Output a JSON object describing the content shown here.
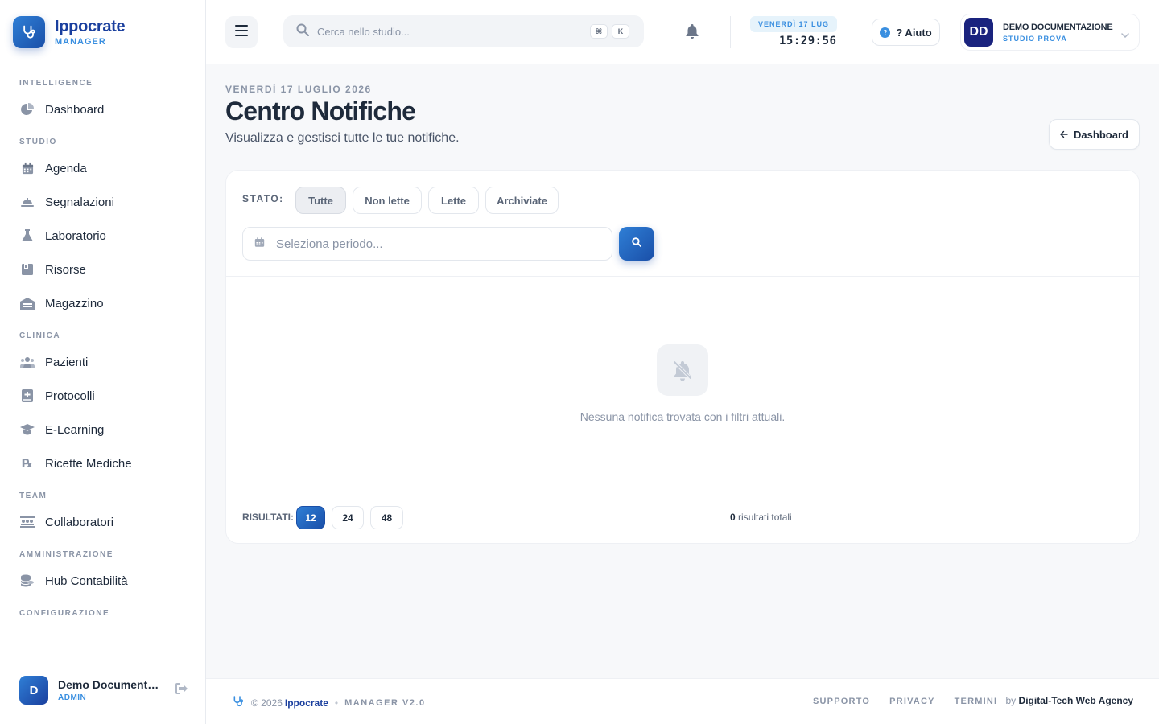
{
  "brand": {
    "name": "Ippocrate",
    "subtitle": "MANAGER"
  },
  "sidebar": {
    "sections": [
      {
        "title": "INTELLIGENCE",
        "items": [
          {
            "label": "Dashboard",
            "icon": "pie-chart-icon"
          }
        ]
      },
      {
        "title": "STUDIO",
        "items": [
          {
            "label": "Agenda",
            "icon": "calendar-icon"
          },
          {
            "label": "Segnalazioni",
            "icon": "bell-service-icon"
          },
          {
            "label": "Laboratorio",
            "icon": "flask-icon"
          },
          {
            "label": "Risorse",
            "icon": "box-icon"
          },
          {
            "label": "Magazzino",
            "icon": "warehouse-icon"
          }
        ]
      },
      {
        "title": "CLINICA",
        "items": [
          {
            "label": "Pazienti",
            "icon": "users-icon"
          },
          {
            "label": "Protocolli",
            "icon": "medical-book-icon"
          },
          {
            "label": "E-Learning",
            "icon": "graduation-cap-icon"
          },
          {
            "label": "Ricette Mediche",
            "icon": "prescription-icon"
          }
        ]
      },
      {
        "title": "TEAM",
        "items": [
          {
            "label": "Collaboratori",
            "icon": "team-icon"
          }
        ]
      },
      {
        "title": "AMMINISTRAZIONE",
        "items": [
          {
            "label": "Hub Contabilità",
            "icon": "coins-icon"
          }
        ]
      },
      {
        "title": "CONFIGURAZIONE",
        "items": []
      }
    ],
    "user": {
      "initial": "D",
      "name": "Demo Documentazione",
      "role": "ADMIN"
    }
  },
  "topbar": {
    "search_placeholder": "Cerca nello studio...",
    "kbd": [
      "⌘",
      "K"
    ],
    "date": "VENERDÌ 17 LUG",
    "time": "15:29:56",
    "help_label": "? Aiuto",
    "user": {
      "initials": "DD",
      "name": "DEMO DOCUMENTAZIONE",
      "studio": "STUDIO PROVA"
    }
  },
  "page": {
    "date": "VENERDÌ 17 LUGLIO 2026",
    "title": "Centro Notifiche",
    "subtitle": "Visualizza e gestisci tutte le tue notifiche.",
    "back_label": "Dashboard"
  },
  "filters": {
    "stato_label": "STATO:",
    "options": [
      "Tutte",
      "Non lette",
      "Lette",
      "Archiviate"
    ],
    "selected": "Tutte",
    "period_placeholder": "Seleziona periodo..."
  },
  "empty": {
    "message": "Nessuna notifica trovata con i filtri attuali."
  },
  "results": {
    "label": "RISULTATI:",
    "sizes": [
      "12",
      "24",
      "48"
    ],
    "selected": "12",
    "total_count": "0",
    "total_label": "risultati totali"
  },
  "footer": {
    "copyright": "© 2026",
    "brand": "Ippocrate",
    "version": "MANAGER V2.0",
    "links": [
      "SUPPORTO",
      "PRIVACY",
      "TERMINI"
    ],
    "by_prefix": "by",
    "agency": "Digital-Tech Web Agency"
  },
  "colors": {
    "primary": "#1a4fa8",
    "accent": "#3a8fe0",
    "brand_text": "#1a3f9e"
  }
}
